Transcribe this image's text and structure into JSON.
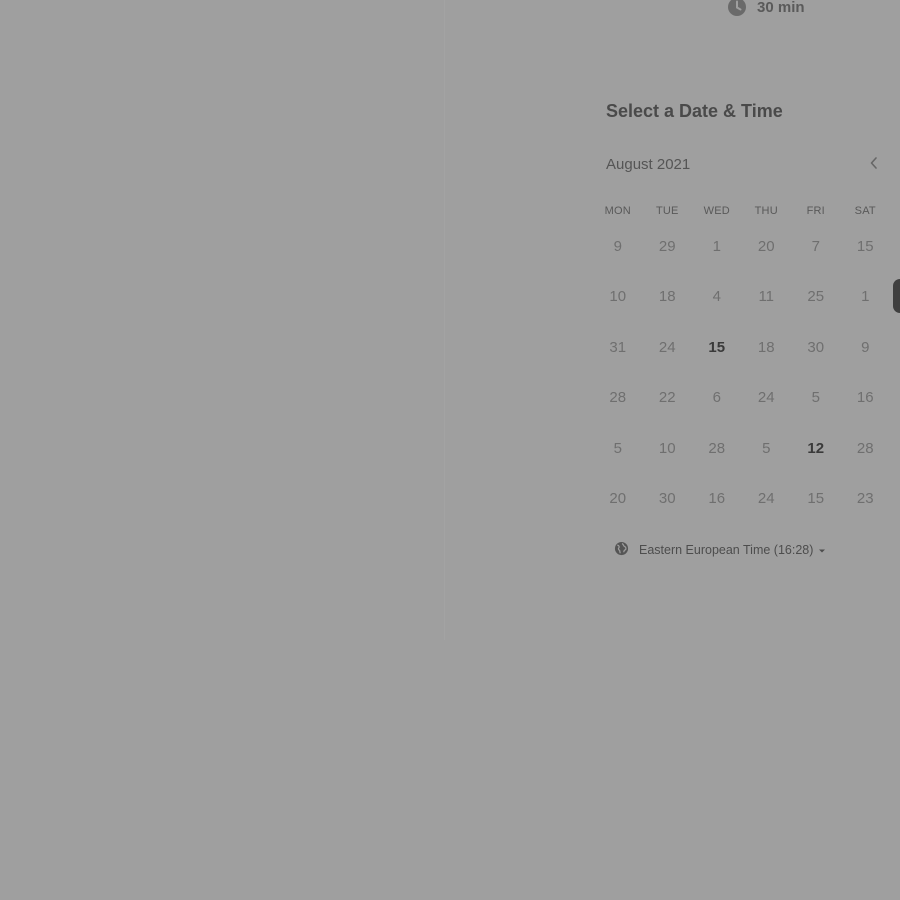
{
  "event": {
    "duration": "30 min"
  },
  "scheduler": {
    "title": "Select a Date & Time",
    "month": "August 2021",
    "weekdays": [
      "MON",
      "TUE",
      "WED",
      "THU",
      "FRI",
      "SAT"
    ],
    "weeks": [
      [
        {
          "label": "9",
          "available": false
        },
        {
          "label": "29",
          "available": false
        },
        {
          "label": "1",
          "available": false
        },
        {
          "label": "20",
          "available": false
        },
        {
          "label": "7",
          "available": false
        },
        {
          "label": "15",
          "available": false
        }
      ],
      [
        {
          "label": "10",
          "available": false
        },
        {
          "label": "18",
          "available": false
        },
        {
          "label": "4",
          "available": false
        },
        {
          "label": "11",
          "available": false
        },
        {
          "label": "25",
          "available": false
        },
        {
          "label": "1",
          "available": false
        }
      ],
      [
        {
          "label": "31",
          "available": false
        },
        {
          "label": "24",
          "available": false
        },
        {
          "label": "15",
          "available": true
        },
        {
          "label": "18",
          "available": false
        },
        {
          "label": "30",
          "available": false
        },
        {
          "label": "9",
          "available": false
        }
      ],
      [
        {
          "label": "28",
          "available": false
        },
        {
          "label": "22",
          "available": false
        },
        {
          "label": "6",
          "available": false
        },
        {
          "label": "24",
          "available": false
        },
        {
          "label": "5",
          "available": false
        },
        {
          "label": "16",
          "available": false
        }
      ],
      [
        {
          "label": "5",
          "available": false
        },
        {
          "label": "10",
          "available": false
        },
        {
          "label": "28",
          "available": false
        },
        {
          "label": "5",
          "available": false
        },
        {
          "label": "12",
          "available": true
        },
        {
          "label": "28",
          "available": false
        }
      ],
      [
        {
          "label": "20",
          "available": false
        },
        {
          "label": "30",
          "available": false
        },
        {
          "label": "16",
          "available": false
        },
        {
          "label": "24",
          "available": false
        },
        {
          "label": "15",
          "available": false
        },
        {
          "label": "23",
          "available": false
        }
      ]
    ],
    "timezone": "Eastern European Time (16:28)"
  },
  "icons": {
    "duration": "clock-icon",
    "prev": "chevron-left-icon",
    "timezone": "globe-icon",
    "timezone_caret": "caret-down-icon"
  },
  "colors": {
    "overlay_background": "#9f9f9f",
    "available_day_text": "#3a3a3a",
    "unavailable_day_text": "#6f6f6f"
  }
}
